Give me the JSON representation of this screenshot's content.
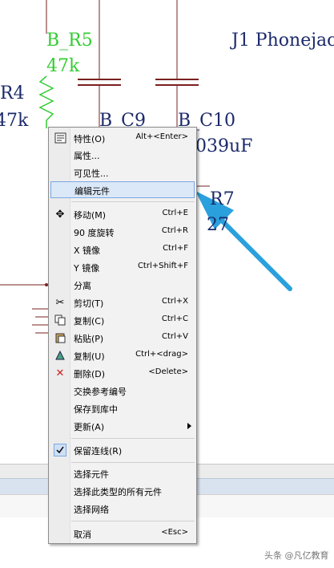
{
  "schematic": {
    "labels": {
      "b_r5": "B_R5",
      "r5_val": "47k",
      "j1": "J1 Phonejac",
      "r4": "R4",
      "r4_val": "47k",
      "b_c9": "B_C9",
      "b_c10": "B_C10",
      "c10_val": "039uF",
      "r7": "R7",
      "r7_val": "27"
    }
  },
  "menu": {
    "items": [
      {
        "label": "特性(O)",
        "shortcut": "Alt+<Enter>"
      },
      {
        "label": "属性...",
        "shortcut": ""
      },
      {
        "label": "可见性...",
        "shortcut": ""
      },
      {
        "label": "编辑元件",
        "shortcut": ""
      },
      {
        "label": "移动(M)",
        "shortcut": "Ctrl+E"
      },
      {
        "label": "90 度旋转",
        "shortcut": "Ctrl+R"
      },
      {
        "label": "X 镜像",
        "shortcut": "Ctrl+F"
      },
      {
        "label": "Y 镜像",
        "shortcut": "Ctrl+Shift+F"
      },
      {
        "label": "分离",
        "shortcut": ""
      },
      {
        "label": "剪切(T)",
        "shortcut": "Ctrl+X"
      },
      {
        "label": "复制(C)",
        "shortcut": "Ctrl+C"
      },
      {
        "label": "粘贴(P)",
        "shortcut": "Ctrl+V"
      },
      {
        "label": "复制(U)",
        "shortcut": "Ctrl+<drag>"
      },
      {
        "label": "删除(D)",
        "shortcut": "<Delete>"
      },
      {
        "label": "交换参考编号",
        "shortcut": ""
      },
      {
        "label": "保存到库中",
        "shortcut": ""
      },
      {
        "label": "更新(A)",
        "shortcut": ""
      },
      {
        "label": "保留连线(R)",
        "shortcut": ""
      },
      {
        "label": "选择元件",
        "shortcut": ""
      },
      {
        "label": "选择此类型的所有元件",
        "shortcut": ""
      },
      {
        "label": "选择网络",
        "shortcut": ""
      },
      {
        "label": "取消",
        "shortcut": "<Esc>"
      }
    ]
  },
  "watermark": "头条 @凡亿教育",
  "colors": {
    "arrow": "#2aa0dc",
    "highlight_bg": "#dbe8f8",
    "wire": "#7a2020"
  }
}
